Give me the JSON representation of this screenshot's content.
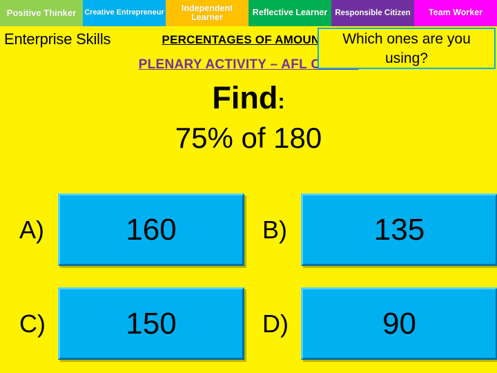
{
  "skill_bar": {
    "items": [
      {
        "label": "Positive Thinker",
        "color": "#92D050"
      },
      {
        "label": "Creative Entrepreneur",
        "color": "#00B0F0"
      },
      {
        "label": "Independent Learner",
        "color": "#FFC000"
      },
      {
        "label": "Reflective Learner",
        "color": "#00B050"
      },
      {
        "label": "Responsible Citizen",
        "color": "#7030A0"
      },
      {
        "label": "Team Worker",
        "color": "#FF00FF"
      }
    ]
  },
  "enterprise": {
    "label": "Enterprise Skills"
  },
  "which_box": {
    "line1": "Which ones are you",
    "line2": "using?"
  },
  "headers": {
    "percentages_title": "PERCENTAGES OF AMOUNTS",
    "plenary_title": "PLENARY ACTIVITY – AFL CARDS"
  },
  "question": {
    "find_label": "Find",
    "find_colon": ":",
    "text": "75% of 180"
  },
  "answers": [
    {
      "letter": "A)",
      "value": "160"
    },
    {
      "letter": "B)",
      "value": "135"
    },
    {
      "letter": "C)",
      "value": "150"
    },
    {
      "letter": "D)",
      "value": "90"
    }
  ]
}
